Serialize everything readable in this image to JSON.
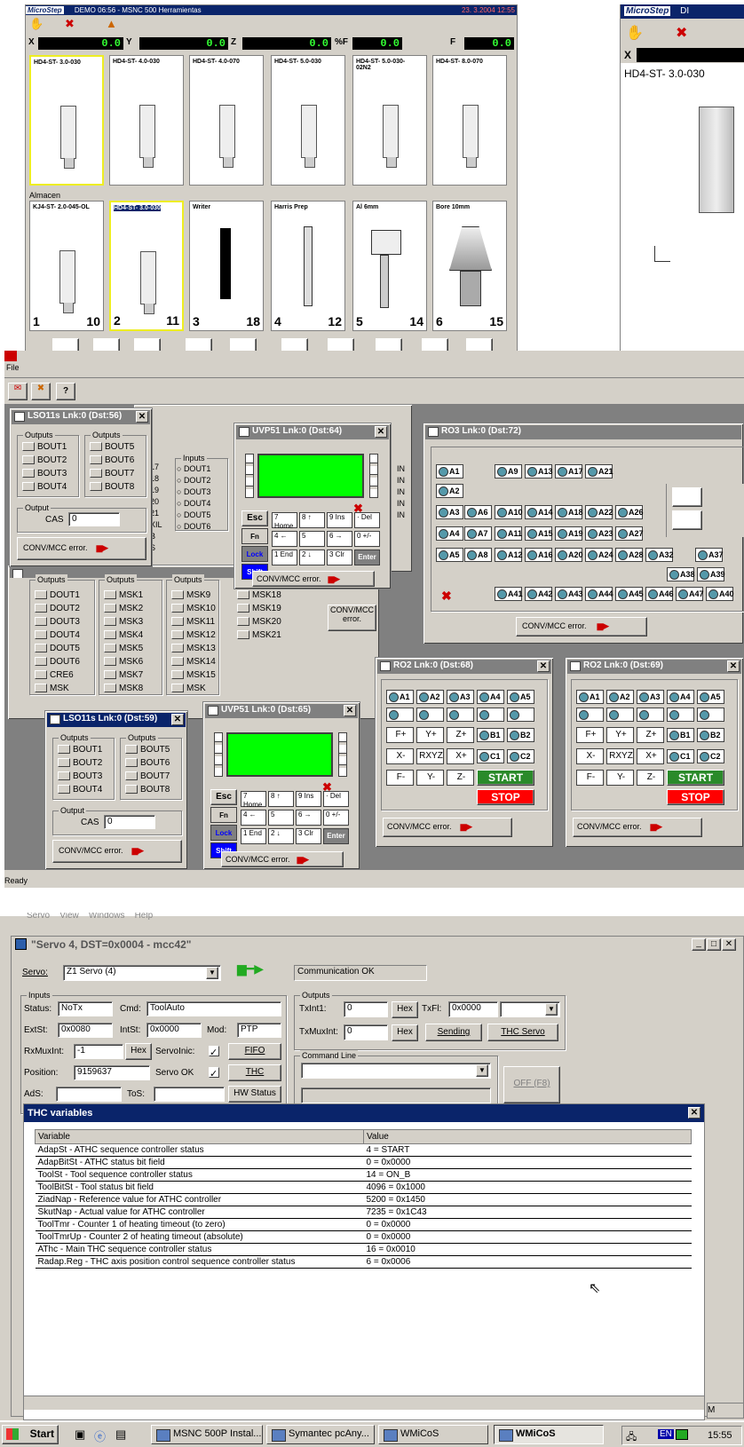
{
  "main_app": {
    "logo": "MicroStep",
    "title": "DEMO 06:56 - MSNC 500 Herramientas",
    "date": "23. 3.2004 12:55",
    "x_label": "X",
    "x_value": "0.0",
    "y_label": "Y",
    "y_value": "0.0",
    "z_label": "Z",
    "z_value": "0.0",
    "feed_pct_label": "%F",
    "feed_pct_value": "0.0",
    "f_label": "F",
    "f_value": "0.0",
    "tools_top": [
      "HD4-ST- 3.0-030",
      "HD4-ST- 4.0-030",
      "HD4-ST- 4.0-070",
      "HD4-ST- 5.0-030",
      "HD4-ST- 5.0-030-02N2",
      "HD4-ST- 8.0-070"
    ],
    "storage_label": "Almacen",
    "tools_bottom": [
      {
        "name": "KJ4-ST- 2.0-045-OL",
        "pos": "1",
        "num": "10"
      },
      {
        "name": "HD4-ST- 3.0-030",
        "pos": "2",
        "num": "11"
      },
      {
        "name": "Writer",
        "pos": "3",
        "num": "18"
      },
      {
        "name": "Harris Prep",
        "pos": "4",
        "num": "12"
      },
      {
        "name": "Al 6mm",
        "pos": "5",
        "num": "14"
      },
      {
        "name": "Bore 10mm",
        "pos": "6",
        "num": "15"
      }
    ]
  },
  "right_app": {
    "logo": "MicroStep",
    "title_partial": "DI",
    "x_label": "X",
    "tool_name": "HD4-ST- 3.0-030"
  },
  "wmicos_top": {
    "file_menu": "File",
    "help_icon": "?",
    "status": "Ready"
  },
  "lso11_a": {
    "title": "LSO11s Lnk:0 (Dst:56)",
    "outputs_caption": "Outputs",
    "col1": [
      "BOUT1",
      "BOUT2",
      "BOUT3",
      "BOUT4"
    ],
    "col2": [
      "BOUT5",
      "BOUT6",
      "BOUT7",
      "BOUT8"
    ],
    "output_caption": "Output",
    "cas_label": "CAS",
    "cas_value": "0",
    "conv_label": "CONV/MCC error."
  },
  "lso11_b": {
    "title": "LSO11s Lnk:0 (Dst:59)",
    "outputs_caption": "Outputs",
    "col1": [
      "BOUT1",
      "BOUT2",
      "BOUT3",
      "BOUT4"
    ],
    "col2": [
      "BOUT5",
      "BOUT6",
      "BOUT7",
      "BOUT8"
    ],
    "output_caption": "Output",
    "cas_label": "CAS",
    "cas_value": "0",
    "conv_label": "CONV/MCC error."
  },
  "inputs_frag": {
    "caption": "Inputs",
    "rows": [
      "DOUT1",
      "DOUT2",
      "DOUT3",
      "DOUT4",
      "DOUT5",
      "DOUT6"
    ],
    "nums": [
      "17",
      "18",
      "19",
      "20",
      "21",
      "XIL",
      "B",
      "S"
    ]
  },
  "outputs_win": {
    "caption1": "Outputs",
    "caption2": "Outputs",
    "caption3": "Outputs",
    "col1": [
      "DOUT1",
      "DOUT2",
      "DOUT3",
      "DOUT4",
      "DOUT5",
      "DOUT6",
      "CRE6",
      "MSK"
    ],
    "col2": [
      "MSK1",
      "MSK2",
      "MSK3",
      "MSK4",
      "MSK5",
      "MSK6",
      "MSK7",
      "MSK8"
    ],
    "col3": [
      "MSK9",
      "MSK10",
      "MSK11",
      "MSK12",
      "MSK13",
      "MSK14",
      "MSK15",
      "MSK"
    ],
    "col4": [
      "MSK18",
      "MSK19",
      "MSK20",
      "MSK21"
    ],
    "conv_label": "CONV/MCC error."
  },
  "uvp_a": {
    "title": "UVP51 Lnk:0 (Dst:64)",
    "esc": "Esc",
    "fn": "Fn",
    "lock": "Lock",
    "shift": "Shift",
    "keys": [
      "7 Home",
      "8 ↑",
      "9 Ins",
      "· Del",
      "4 ←",
      "5",
      "6 →",
      "0 +/-",
      "1 End",
      "2 ↓",
      "3 Clr",
      "Enter"
    ],
    "conv_label": "CONV/MCC error."
  },
  "uvp_b": {
    "title": "UVP51 Lnk:0 (Dst:65)",
    "esc": "Esc",
    "fn": "Fn",
    "lock": "Lock",
    "shift": "Shift",
    "keys": [
      "7 Home",
      "8 ↑",
      "9 Ins",
      "· Del",
      "4 ←",
      "5",
      "6 →",
      "0 +/-",
      "1 End",
      "2 ↓",
      "3 Clr",
      "Enter"
    ],
    "conv_label": "CONV/MCC error."
  },
  "ro3": {
    "title": "RO3 Lnk:0 (Dst:72)",
    "buttons": [
      "A1",
      "A9",
      "A13",
      "A17",
      "A21",
      "A2",
      "A2",
      "A3",
      "A6",
      "A10",
      "A14",
      "A18",
      "A22",
      "A26",
      "A4",
      "A7",
      "A11",
      "A15",
      "A19",
      "A23",
      "A27",
      "A5",
      "A8",
      "A12",
      "A16",
      "A20",
      "A24",
      "A28",
      "A32",
      "A37",
      "A38",
      "A39",
      "A41",
      "A42",
      "A43",
      "A44",
      "A45",
      "A46",
      "A47",
      "A40"
    ],
    "conv_label": "CONV/MCC error.",
    "in_labels": [
      "IN",
      "IN",
      "IN",
      "IN",
      "IN"
    ]
  },
  "ro2_a": {
    "title": "RO2 Lnk:0 (Dst:68)",
    "row1": [
      "A1",
      "A2",
      "A3",
      "A4",
      "A5"
    ],
    "row3": [
      "F+",
      "Y+",
      "Z+",
      "B1",
      "B2"
    ],
    "row4": [
      "X-",
      "RXYZ",
      "X+",
      "C1",
      "C2"
    ],
    "row5": [
      "F-",
      "Y-",
      "Z-"
    ],
    "start": "START",
    "stop": "STOP",
    "conv_label": "CONV/MCC error."
  },
  "ro2_b": {
    "title": "RO2 Lnk:0 (Dst:69)",
    "row1": [
      "A1",
      "A2",
      "A3",
      "A4",
      "A5"
    ],
    "row3": [
      "F+",
      "Y+",
      "Z+",
      "B1",
      "B2"
    ],
    "row4": [
      "X-",
      "RXYZ",
      "X+",
      "C1",
      "C2"
    ],
    "row5": [
      "F-",
      "Y-",
      "Z-"
    ],
    "start": "START",
    "stop": "STOP",
    "conv_label": "CONV/MCC error."
  },
  "servo": {
    "menu": [
      "Servo",
      "View",
      "Windows",
      "Help"
    ],
    "title": "\"Servo 4, DST=0x0004 - mcc42\"",
    "servo_label": "Servo:",
    "servo_value": "Z1 Servo (4)",
    "comm_status": "Communication OK",
    "inputs_caption": "Inputs",
    "status_label": "Status:",
    "status_value": "NoTx",
    "cmd_label": "Cmd:",
    "cmd_value": "ToolAuto",
    "extst_label": "ExtSt:",
    "extst_value": "0x0080",
    "intst_label": "IntSt:",
    "intst_value": "0x0000",
    "mod_label": "Mod:",
    "mod_value": "PTP",
    "rxmux_label": "RxMuxInt:",
    "rxmux_value": "-1",
    "hex": "Hex",
    "servoinic_label": "ServoInic:",
    "fifo": "FIFO",
    "position_label": "Position:",
    "position_value": "9159637",
    "servook_label": "Servo OK",
    "thc": "THC",
    "ads_label": "AdS:",
    "tos_label": "ToS:",
    "hwstatus": "HW Status",
    "outputs_caption": "Outputs",
    "txint1_label": "TxInt1:",
    "txint1_value": "0",
    "txfl_label": "TxFl:",
    "txfl_value": "0x0000",
    "txmux_label": "TxMuxInt:",
    "txmux_value": "0",
    "sending": "Sending",
    "thcservo": "THC Servo",
    "cmdline_caption": "Command Line",
    "off": "OFF (F8)"
  },
  "thc": {
    "title": "THC variables",
    "col_var": "Variable",
    "col_val": "Value",
    "rows": [
      [
        "AdapSt - ATHC sequence controller status",
        "4 = START"
      ],
      [
        "AdapBitSt - ATHC status bit field",
        "0 = 0x0000"
      ],
      [
        "ToolSt - Tool sequence controller status",
        "14 = ON_B"
      ],
      [
        "ToolBitSt - Tool status bit field",
        "4096 = 0x1000"
      ],
      [
        "ZiadNap - Reference value for ATHC controller",
        "5200 = 0x1450"
      ],
      [
        "SkutNap - Actual value for ATHC controller",
        "7235 = 0x1C43"
      ],
      [
        "ToolTmr - Counter 1 of heating timeout (to zero)",
        "0 = 0x0000"
      ],
      [
        "ToolTmrUp - Counter 2 of heating timeout (absolute)",
        "0 = 0x0000"
      ],
      [
        "AThc - Main THC sequence controller status",
        "16 = 0x0010"
      ],
      [
        "Radap.Reg - THC axis position control sequence controller status",
        "6 = 0x0006"
      ]
    ]
  },
  "taskbar": {
    "start": "Start",
    "items": [
      "MSNC 500P Instal...",
      "Symantec pcAny...",
      "WMiCoS",
      "WMiCoS"
    ],
    "lang": "EN",
    "time": "15:55",
    "m": "M"
  }
}
